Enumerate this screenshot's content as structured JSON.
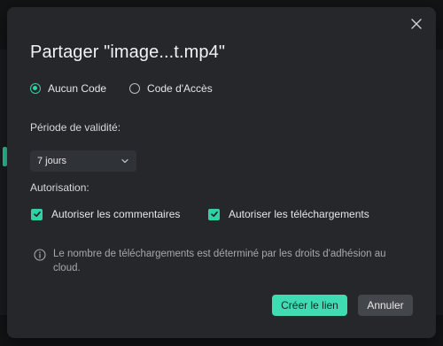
{
  "dialog": {
    "title": "Partager \"image...t.mp4\"",
    "access_options": [
      {
        "label": "Aucun Code",
        "selected": true
      },
      {
        "label": "Code d'Accès",
        "selected": false
      }
    ],
    "validity_label": "Période de validité:",
    "validity_value": "7 jours",
    "authorization_label": "Autorisation:",
    "permissions": [
      {
        "label": "Autoriser les commentaires",
        "checked": true
      },
      {
        "label": "Autoriser les téléchargements",
        "checked": true
      }
    ],
    "info_text": "Le nombre de téléchargements est déterminé par les droits d'adhésion au cloud.",
    "create_button": "Créer le lien",
    "cancel_button": "Annuler"
  },
  "icons": {
    "close": "close-icon",
    "dropdown": "chevron-down-icon",
    "check": "check-icon",
    "info": "info-icon"
  },
  "colors": {
    "accent": "#2fd1a5",
    "dialog_bg": "#25272b",
    "page_bg": "#121416"
  }
}
